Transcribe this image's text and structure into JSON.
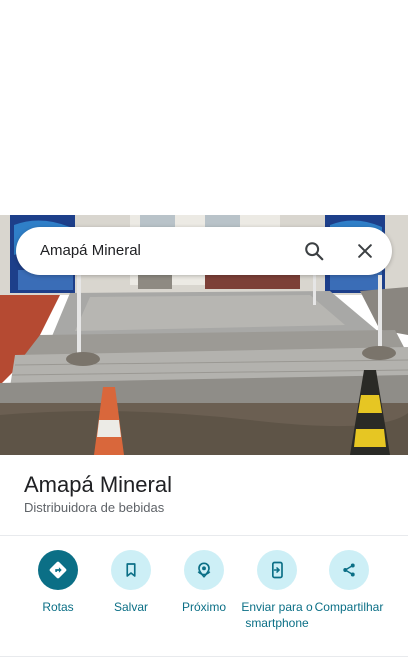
{
  "search": {
    "query": "Amapá Mineral"
  },
  "place": {
    "name": "Amapá Mineral",
    "category": "Distribuidora de bebidas"
  },
  "actions": [
    {
      "label": "Rotas",
      "icon": "directions-icon"
    },
    {
      "label": "Salvar",
      "icon": "bookmark-icon"
    },
    {
      "label": "Próximo",
      "icon": "nearby-icon"
    },
    {
      "label": "Enviar para o smartphone",
      "icon": "send-to-phone-icon"
    },
    {
      "label": "Compartilhar",
      "icon": "share-icon"
    }
  ],
  "colors": {
    "accent": "#0b6f86",
    "accent_light": "#cdeff6",
    "title_text": "#202124",
    "secondary_text": "#5f6368"
  }
}
